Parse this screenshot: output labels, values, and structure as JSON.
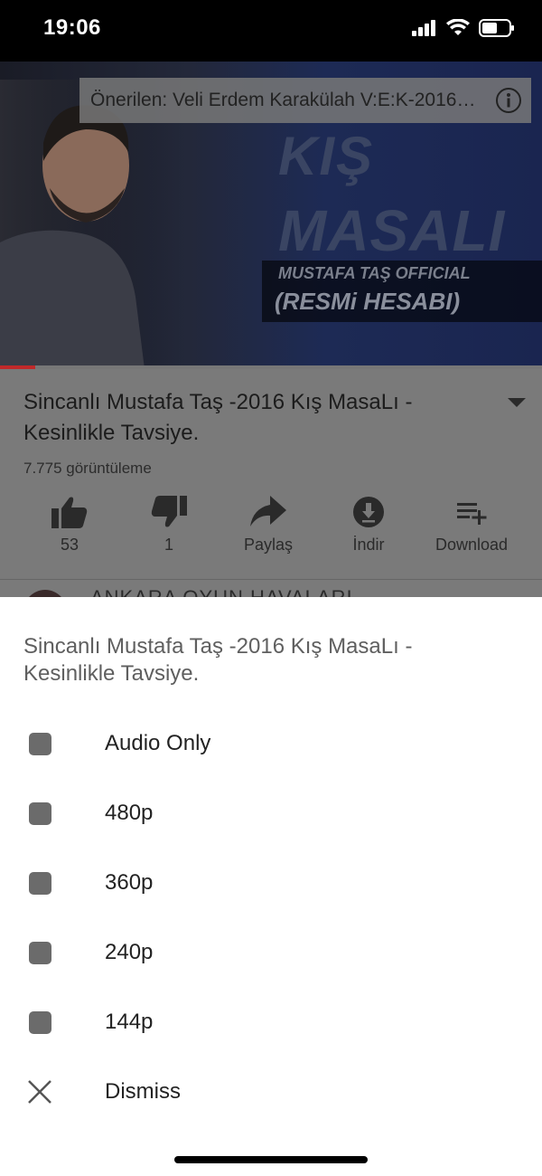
{
  "status_bar": {
    "time": "19:06"
  },
  "video": {
    "suggestion": "Önerilen: Veli Erdem Karakülah V:E:K-2016…",
    "overlay_line1": "KIŞ",
    "overlay_line2": "MASALI",
    "overlay_sub1": "MUSTAFA TAŞ OFFICIAL",
    "overlay_sub2": "(RESMi HESABI)",
    "progress_percent": 6.5
  },
  "info": {
    "title": "Sincanlı Mustafa Taş -2016 Kış MasaLı  - Kesinlikle Tavsiye.",
    "views": "7.775 görüntüleme",
    "actions": [
      {
        "label": "53",
        "icon": "thumbs-up-icon"
      },
      {
        "label": "1",
        "icon": "thumbs-down-icon"
      },
      {
        "label": "Paylaş",
        "icon": "share-icon"
      },
      {
        "label": "İndir",
        "icon": "download-circle-icon"
      },
      {
        "label": "Download",
        "icon": "playlist-add-icon"
      }
    ],
    "channel_peek": "ANKARA OYUN HAVALARI"
  },
  "sheet": {
    "title": "Sincanlı Mustafa Taş -2016 Kış MasaLı  - Kesinlikle Tavsiye.",
    "options": [
      "Audio Only",
      "480p",
      "360p",
      "240p",
      "144p"
    ],
    "dismiss": "Dismiss"
  }
}
